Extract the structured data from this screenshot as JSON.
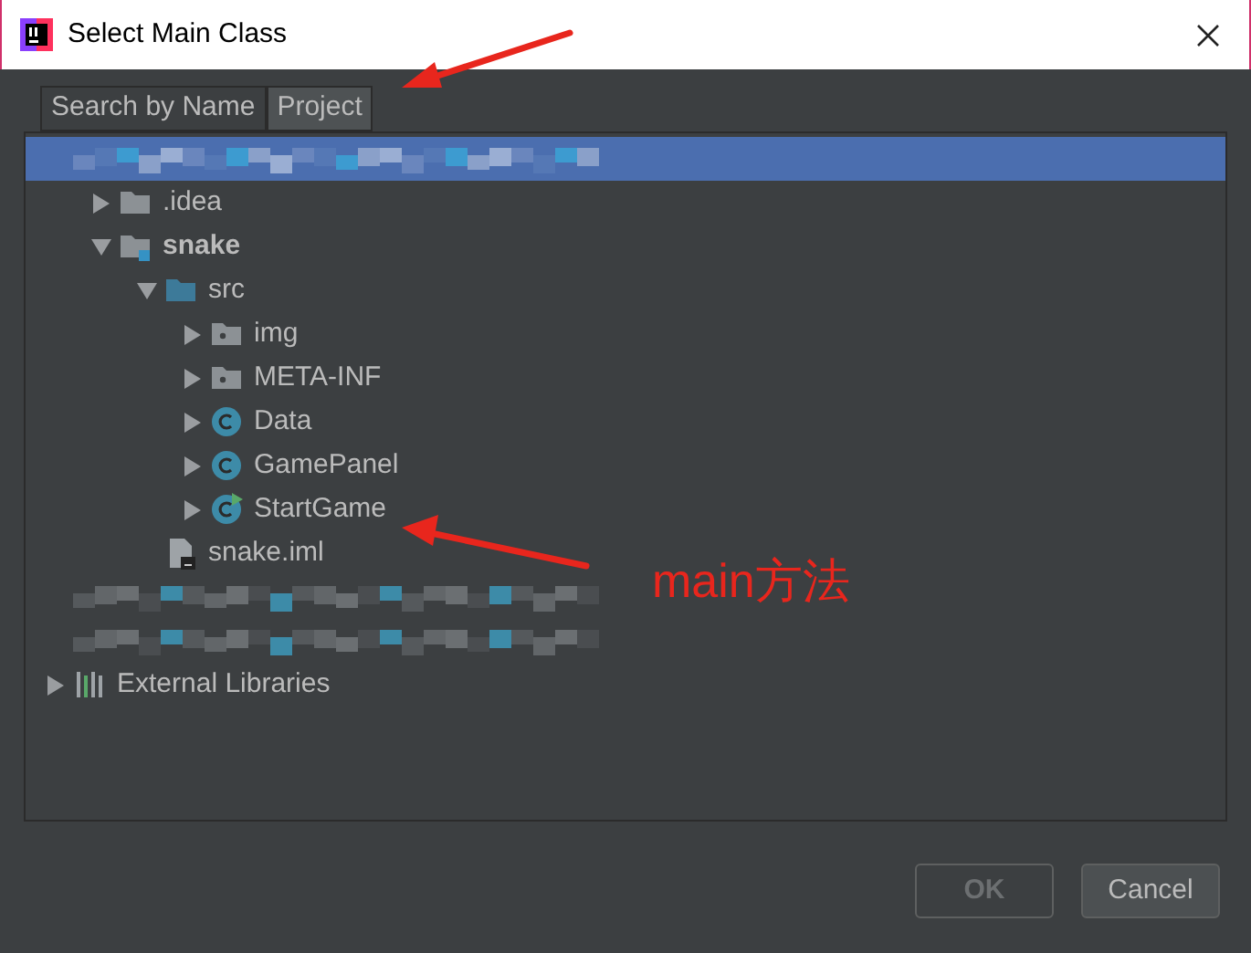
{
  "window": {
    "title": "Select Main Class"
  },
  "tabs": [
    {
      "label": "Search by Name",
      "selected": false
    },
    {
      "label": "Project",
      "selected": true
    }
  ],
  "tree": [
    {
      "kind": "blurred",
      "selected": true,
      "expanded": true,
      "children": [
        {
          "kind": "folder",
          "label": ".idea",
          "expanded": false,
          "selected": false
        },
        {
          "kind": "module",
          "label": "snake",
          "bold": true,
          "expanded": true,
          "selected": false,
          "children": [
            {
              "kind": "source",
              "label": "src",
              "expanded": true,
              "selected": false,
              "children": [
                {
                  "kind": "package",
                  "label": "img",
                  "expanded": false,
                  "selected": false
                },
                {
                  "kind": "package",
                  "label": "META-INF",
                  "expanded": false,
                  "selected": false
                },
                {
                  "kind": "class",
                  "label": "Data",
                  "expanded": false,
                  "selected": false
                },
                {
                  "kind": "class",
                  "label": "GamePanel",
                  "expanded": false,
                  "selected": false
                },
                {
                  "kind": "main-class",
                  "label": "StartGame",
                  "expanded": false,
                  "selected": false
                }
              ]
            },
            {
              "kind": "file",
              "label": "snake.iml",
              "selected": false
            }
          ]
        }
      ]
    },
    {
      "kind": "blurred",
      "selected": false
    },
    {
      "kind": "blurred",
      "selected": false
    },
    {
      "kind": "library",
      "label": "External Libraries",
      "expanded": false,
      "selected": false
    }
  ],
  "buttons": [
    {
      "label": "OK",
      "disabled": true
    },
    {
      "label": "Cancel",
      "disabled": false
    }
  ],
  "annotation": {
    "text": "main方法"
  }
}
